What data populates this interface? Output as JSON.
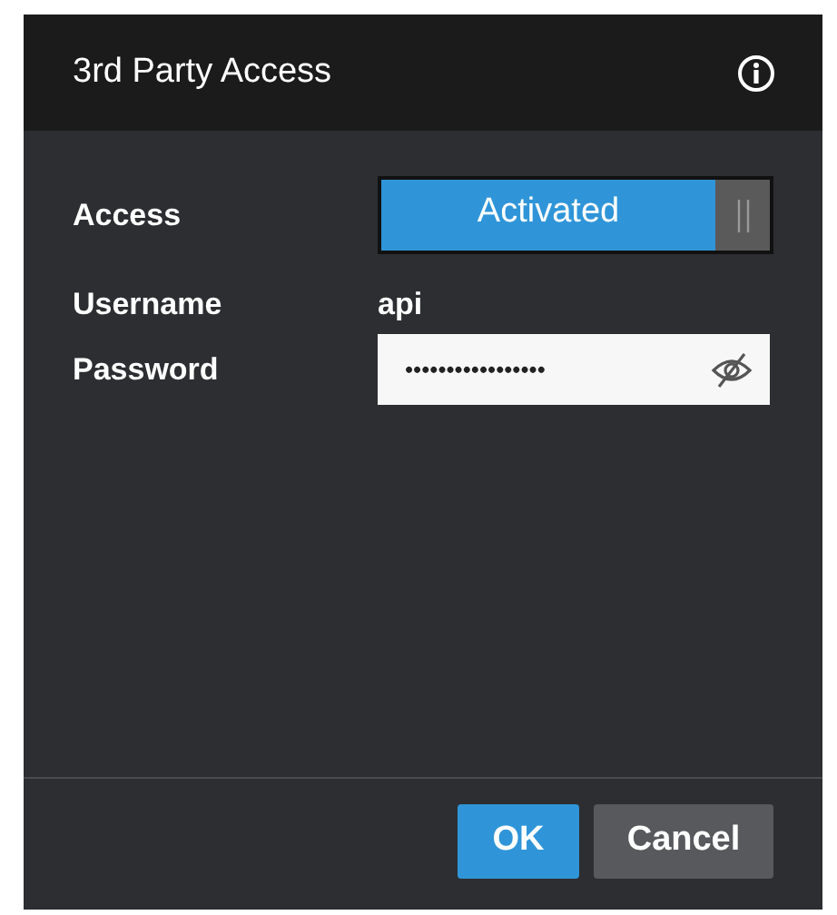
{
  "dialog": {
    "title": "3rd Party Access",
    "fields": [
      {
        "kind": "toggle",
        "label": "Access",
        "value": "Activated",
        "on": true
      },
      {
        "kind": "text",
        "label": "Username",
        "value": "api"
      },
      {
        "kind": "password",
        "label": "Password",
        "value": "•••••••••••••••••"
      }
    ],
    "buttons": [
      {
        "label": "OK",
        "primary": true
      },
      {
        "label": "Cancel",
        "primary": false
      }
    ]
  }
}
